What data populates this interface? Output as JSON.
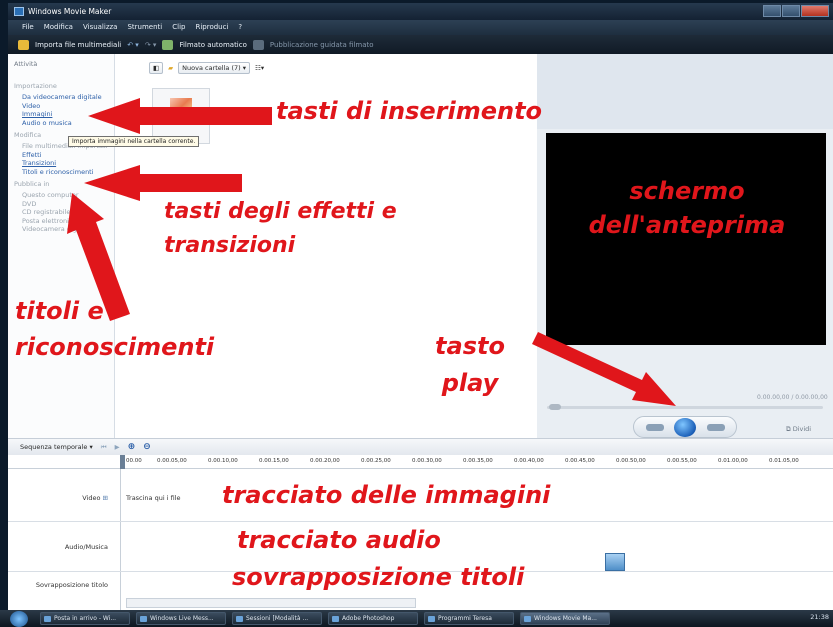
{
  "window": {
    "title": "Windows Movie Maker"
  },
  "menu": [
    "File",
    "Modifica",
    "Visualizza",
    "Strumenti",
    "Clip",
    "Riproduci",
    "?"
  ],
  "toolbar": {
    "import_label": "Importa file multimediali",
    "auto_movie_label": "Filmato automatico",
    "publish_label": "Pubblicazione guidata filmato"
  },
  "tasks": {
    "title": "Attività",
    "import_group": "Importazione",
    "import_items": [
      "Da videocamera digitale",
      "Video",
      "Immagini",
      "Audio o musica"
    ],
    "tooltip": "Importa immagini nella cartella corrente.",
    "edit_group": "Modifica",
    "edit_items": [
      "File multimediali importati",
      "Effetti",
      "Transizioni",
      "Titoli e riconoscimenti"
    ],
    "publish_group": "Pubblica in",
    "publish_items": [
      "Questo computer",
      "DVD",
      "CD registrabile",
      "Posta elettronica",
      "Videocamera digitale"
    ]
  },
  "content": {
    "folder_label": "Nuova cartella (7)"
  },
  "preview": {
    "time": "0.00.00,00 / 0.00.00,00",
    "split_label": "Dividi"
  },
  "timeline": {
    "view_label": "Sequenza temporale",
    "ruler": [
      "00.00",
      "0.00.05,00",
      "0.00.10,00",
      "0.00.15,00",
      "0.00.20,00",
      "0.00.25,00",
      "0.00.30,00",
      "0.00.35,00",
      "0.00.40,00",
      "0.00.45,00",
      "0.00.50,00",
      "0.00.55,00",
      "0.01.00,00",
      "0.01.05,00"
    ],
    "tracks": [
      "Video",
      "Audio/Musica",
      "Sovrapposizione titolo"
    ],
    "drop_text": "Trascina qui i file"
  },
  "taskbar": {
    "items": [
      "Posta in arrivo - Wi...",
      "Windows Live Mess...",
      "Sessioni [Modalità ...",
      "Adobe Photoshop",
      "Programmi Teresa",
      "Windows Movie Ma..."
    ],
    "clock": "21:38"
  },
  "annotations": {
    "insert_buttons": "tasti di inserimento",
    "effects_line1": "tasti degli effetti e",
    "effects_line2": "transizioni",
    "titles_line1": "titoli e",
    "titles_line2": "riconoscimenti",
    "preview_line1": "schermo",
    "preview_line2": "dell'anteprima",
    "play_line1": "tasto",
    "play_line2": "play",
    "image_track": "tracciato delle immagini",
    "audio_track": "tracciato audio",
    "title_overlay": "sovrapposizione titoli"
  },
  "colors": {
    "annotation": "#e0161b",
    "chrome": "#1e2e3f",
    "link": "#2c5fa8"
  }
}
